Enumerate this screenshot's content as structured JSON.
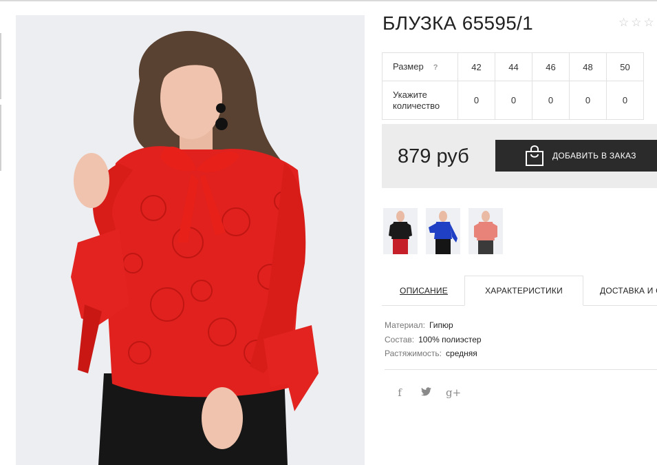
{
  "product": {
    "title": "БЛУЗКА 65595/1",
    "rating_stars": [
      "☆",
      "☆",
      "☆"
    ],
    "price": "879 руб",
    "add_to_order": "ДОБАВИТЬ В ЗАКАЗ"
  },
  "sizes": {
    "size_label": "Размер",
    "help": "?",
    "qty_label_line1": "Укажите",
    "qty_label_line2": "количество",
    "values": [
      "42",
      "44",
      "46",
      "48",
      "50"
    ],
    "quantities": [
      "0",
      "0",
      "0",
      "0",
      "0"
    ]
  },
  "thumbnails": [
    {
      "name": "black",
      "color": "#1a1a1a"
    },
    {
      "name": "blue",
      "color": "#1f3fc4"
    },
    {
      "name": "pink",
      "color": "#e8837a"
    }
  ],
  "tabs": {
    "description": "ОПИСАНИЕ",
    "characteristics": "ХАРАКТЕРИСТИКИ",
    "delivery": "ДОСТАВКА И С"
  },
  "specs": [
    {
      "key": "Материал:",
      "value": "Гипюр"
    },
    {
      "key": "Состав:",
      "value": "100% полиэстер"
    },
    {
      "key": "Растяжимость:",
      "value": "средняя"
    }
  ],
  "social": {
    "facebook": "f",
    "twitter": "🐦",
    "gplus": "g+"
  },
  "colors": {
    "blouse": "#e0211d",
    "button": "#2b2b2b",
    "price_box": "#ececec"
  }
}
